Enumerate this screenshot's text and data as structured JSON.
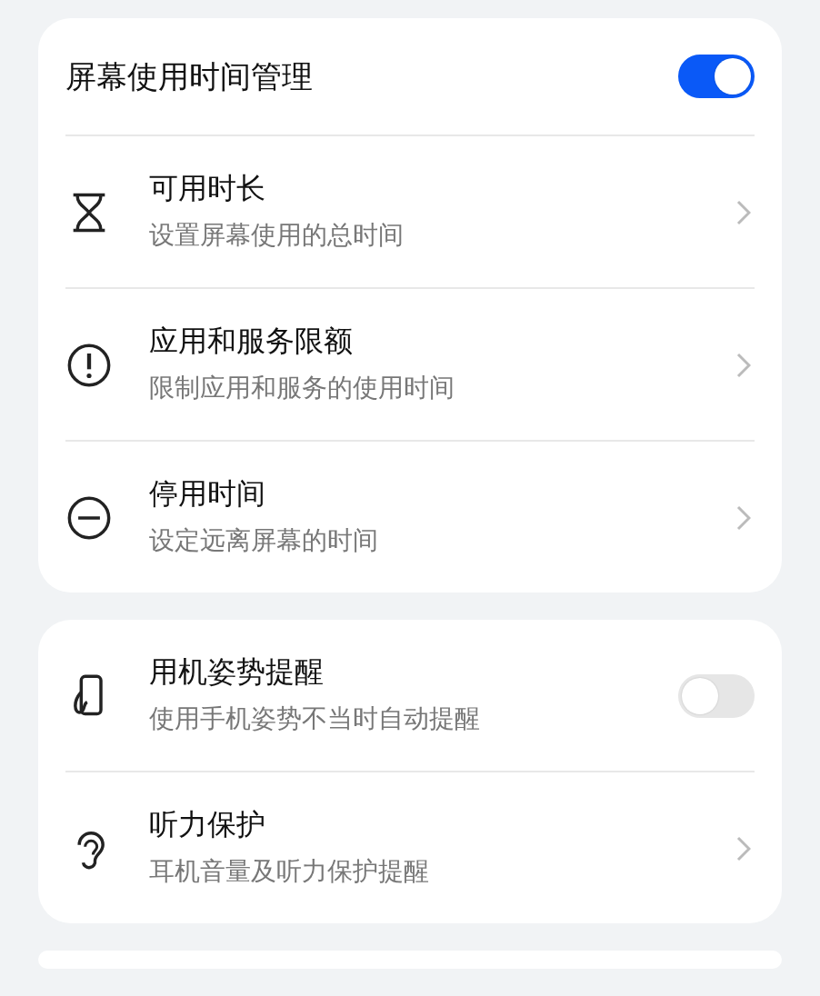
{
  "cards": [
    {
      "header": {
        "title": "屏幕使用时间管理",
        "on": true
      },
      "items": [
        {
          "kind": "nav",
          "title": "可用时长",
          "subtitle": "设置屏幕使用的总时间"
        },
        {
          "kind": "nav",
          "title": "应用和服务限额",
          "subtitle": "限制应用和服务的使用时间"
        },
        {
          "kind": "nav",
          "title": "停用时间",
          "subtitle": "设定远离屏幕的时间"
        }
      ]
    },
    {
      "items": [
        {
          "kind": "toggle",
          "title": "用机姿势提醒",
          "subtitle": "使用手机姿势不当时自动提醒",
          "on": false
        },
        {
          "kind": "nav",
          "title": "听力保护",
          "subtitle": "耳机音量及听力保护提醒"
        }
      ]
    }
  ]
}
